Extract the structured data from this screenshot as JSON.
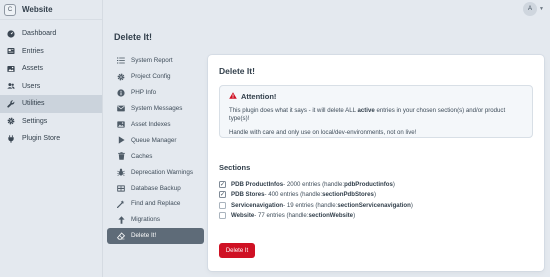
{
  "site": {
    "badge": "C",
    "name": "Website"
  },
  "user": {
    "initial": "A"
  },
  "nav": [
    {
      "label": "Dashboard",
      "icon": "gauge-icon"
    },
    {
      "label": "Entries",
      "icon": "newspaper-icon"
    },
    {
      "label": "Assets",
      "icon": "image-icon"
    },
    {
      "label": "Users",
      "icon": "users-icon"
    },
    {
      "label": "Utilities",
      "icon": "wrench-icon",
      "active": true
    },
    {
      "label": "Settings",
      "icon": "gear-icon"
    },
    {
      "label": "Plugin Store",
      "icon": "plug-icon"
    }
  ],
  "page": {
    "title": "Delete It!"
  },
  "subnav": [
    {
      "label": "System Report",
      "icon": "list-icon"
    },
    {
      "label": "Project Config",
      "icon": "gear-icon"
    },
    {
      "label": "PHP Info",
      "icon": "info-icon"
    },
    {
      "label": "System Messages",
      "icon": "envelope-icon"
    },
    {
      "label": "Asset Indexes",
      "icon": "image-icon"
    },
    {
      "label": "Queue Manager",
      "icon": "play-icon"
    },
    {
      "label": "Caches",
      "icon": "trash-icon"
    },
    {
      "label": "Deprecation Warnings",
      "icon": "bug-icon"
    },
    {
      "label": "Database Backup",
      "icon": "database-icon"
    },
    {
      "label": "Find and Replace",
      "icon": "magic-icon"
    },
    {
      "label": "Migrations",
      "icon": "arrow-up-icon"
    },
    {
      "label": "Delete It!",
      "icon": "eraser-icon",
      "active": true
    }
  ],
  "card": {
    "title": "Delete It!",
    "attention": {
      "heading": "Attention!",
      "body_prefix": "This plugin does what it says - it will delete ALL ",
      "body_bold": "active",
      "body_suffix": " entries in your chosen section(s) and/or product type(s)!",
      "care": "Handle with care and only use on local/dev-environments, not on live!"
    },
    "sections_heading": "Sections",
    "sections": [
      {
        "name": "PDB ProductInfos",
        "count": " - 2000 entries (handle: ",
        "handle": "pdbProductinfos",
        "close": ")",
        "checked": true
      },
      {
        "name": "PDB Stores",
        "count": " - 400 entries (handle: ",
        "handle": "sectionPdbStores",
        "close": ")",
        "checked": true
      },
      {
        "name": "Servicenavigation",
        "count": " - 19 entries (handle: ",
        "handle": "sectionServicenavigation",
        "close": ")",
        "checked": false
      },
      {
        "name": "Website",
        "count": " - 77 entries (handle: ",
        "handle": "sectionWebsite",
        "close": ")",
        "checked": false
      }
    ],
    "delete_label": "Delete It"
  },
  "colors": {
    "danger": "#cf1124",
    "sidebar_bg": "#e4e9ef",
    "active_subnav": "#5e6b78"
  }
}
